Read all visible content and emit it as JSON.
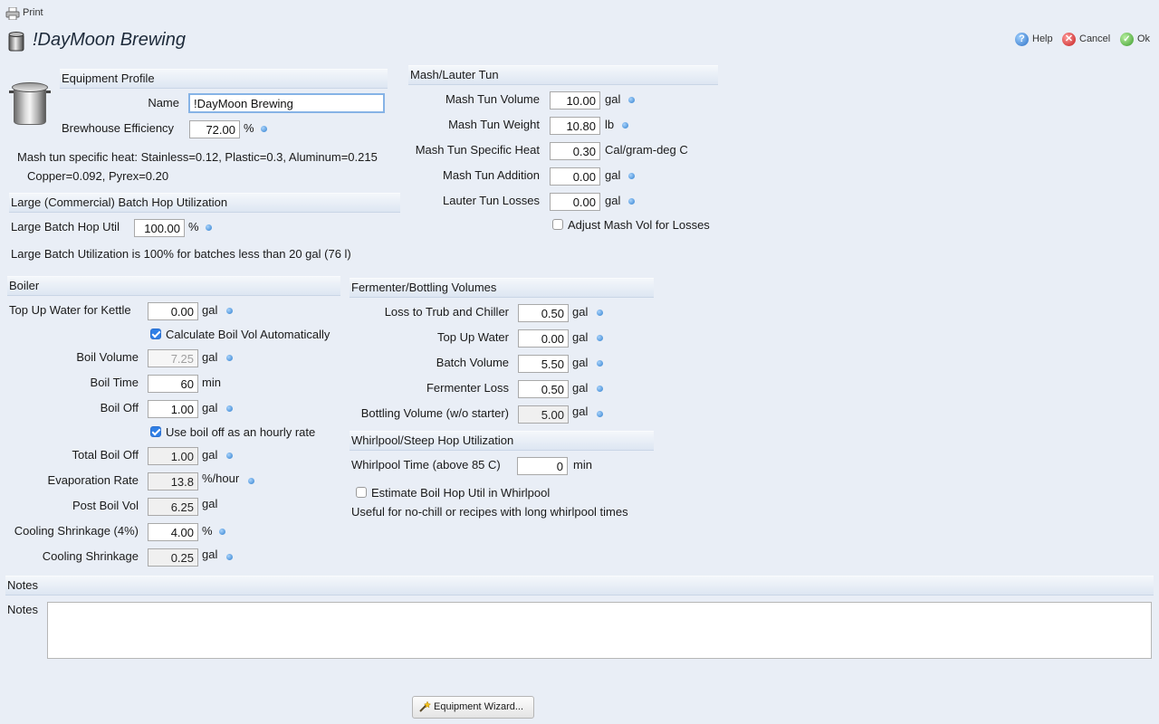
{
  "toolbar": {
    "print_label": "Print"
  },
  "header": {
    "title": "!DayMoon Brewing",
    "help_label": "Help",
    "cancel_label": "Cancel",
    "ok_label": "Ok"
  },
  "equipment_profile": {
    "section_label": "Equipment Profile",
    "name_label": "Name",
    "name_value": "!DayMoon Brewing",
    "efficiency_label": "Brewhouse Efficiency",
    "efficiency_value": "72.00",
    "efficiency_unit": "%",
    "specific_heat_note_line1": "Mash tun specific heat: Stainless=0.12, Plastic=0.3, Aluminum=0.215",
    "specific_heat_note_line2": "Copper=0.092, Pyrex=0.20"
  },
  "hop_util": {
    "section_label": "Large (Commercial) Batch Hop Utilization",
    "util_label": "Large Batch Hop Util",
    "util_value": "100.00",
    "util_unit": "%",
    "note": "Large Batch Utilization is 100% for batches less than 20 gal (76 l)"
  },
  "mash": {
    "section_label": "Mash/Lauter Tun",
    "volume_label": "Mash Tun Volume",
    "volume_value": "10.00",
    "volume_unit": "gal",
    "weight_label": "Mash Tun Weight",
    "weight_value": "10.80",
    "weight_unit": "lb",
    "heat_label": "Mash Tun Specific Heat",
    "heat_value": "0.30",
    "heat_unit": "Cal/gram-deg C",
    "addition_label": "Mash Tun Addition",
    "addition_value": "0.00",
    "addition_unit": "gal",
    "losses_label": "Lauter Tun Losses",
    "losses_value": "0.00",
    "losses_unit": "gal",
    "adjust_label": "Adjust Mash Vol for Losses",
    "adjust_checked": false
  },
  "boiler": {
    "section_label": "Boiler",
    "topup_label": "Top Up Water for Kettle",
    "topup_value": "0.00",
    "topup_unit": "gal",
    "calc_label": "Calculate Boil Vol Automatically",
    "calc_checked": true,
    "boil_volume_label": "Boil Volume",
    "boil_volume_value": "7.25",
    "boil_volume_unit": "gal",
    "boil_time_label": "Boil Time",
    "boil_time_value": "60",
    "boil_time_unit": "min",
    "boil_off_label": "Boil Off",
    "boil_off_value": "1.00",
    "boil_off_unit": "gal",
    "hourly_label": "Use boil off as an hourly rate",
    "hourly_checked": true,
    "total_boil_off_label": "Total Boil Off",
    "total_boil_off_value": "1.00",
    "total_boil_off_unit": "gal",
    "evap_label": "Evaporation Rate",
    "evap_value": "13.8",
    "evap_unit": "%/hour",
    "post_boil_label": "Post Boil Vol",
    "post_boil_value": "6.25",
    "post_boil_unit": "gal",
    "shrink_pct_label": "Cooling Shrinkage (4%)",
    "shrink_pct_value": "4.00",
    "shrink_pct_unit": "%",
    "shrink_label": "Cooling Shrinkage",
    "shrink_value": "0.25",
    "shrink_unit": "gal"
  },
  "fermenter": {
    "section_label": "Fermenter/Bottling Volumes",
    "trub_label": "Loss to Trub and Chiller",
    "trub_value": "0.50",
    "trub_unit": "gal",
    "topup_label": "Top Up Water",
    "topup_value": "0.00",
    "topup_unit": "gal",
    "batch_label": "Batch Volume",
    "batch_value": "5.50",
    "batch_unit": "gal",
    "ferm_loss_label": "Fermenter Loss",
    "ferm_loss_value": "0.50",
    "ferm_loss_unit": "gal",
    "bottling_label": "Bottling Volume (w/o starter)",
    "bottling_value": "5.00",
    "bottling_unit": "gal"
  },
  "whirlpool": {
    "section_label": "Whirlpool/Steep Hop Utilization",
    "time_label": "Whirlpool Time (above 85 C)",
    "time_value": "0",
    "time_unit": "min",
    "estimate_label": "Estimate Boil Hop Util in Whirlpool",
    "estimate_checked": false,
    "note": "Useful for no-chill or recipes with long whirlpool times"
  },
  "notes": {
    "section_label": "Notes",
    "field_label": "Notes",
    "value": ""
  },
  "footer": {
    "wizard_label": "Equipment Wizard..."
  },
  "colors": {
    "background": "#e9eef6",
    "info_dot": "#2f7fd0",
    "checkbox_accent": "#2f7fe6"
  }
}
